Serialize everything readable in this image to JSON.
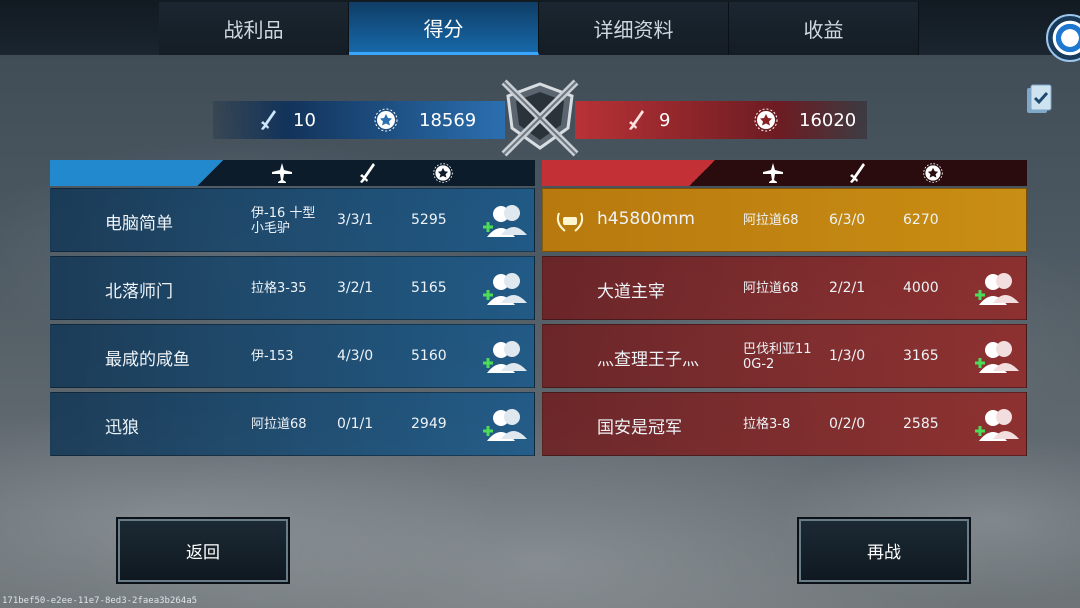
{
  "tabs": [
    {
      "label": "战利品"
    },
    {
      "label": "得分"
    },
    {
      "label": "详细资料"
    },
    {
      "label": "收益"
    }
  ],
  "active_tab": "得分",
  "blue_team": {
    "kills": "10",
    "score": "18569",
    "rows": [
      {
        "name": "电脑简单",
        "plane": "伊-16 十型\n小毛驴",
        "kda": "3/3/1",
        "score": "5295"
      },
      {
        "name": "北落师门",
        "plane": "拉格3-35",
        "kda": "3/2/1",
        "score": "5165"
      },
      {
        "name": "最咸的咸鱼",
        "plane": "伊-153",
        "kda": "4/3/0",
        "score": "5160"
      },
      {
        "name": "迅狼",
        "plane": "阿拉道68",
        "kda": "0/1/1",
        "score": "2949"
      }
    ]
  },
  "red_team": {
    "kills": "9",
    "score": "16020",
    "rows": [
      {
        "name": "h45800mm",
        "plane": "阿拉道68",
        "kda": "6/3/0",
        "score": "6270",
        "highlight": true
      },
      {
        "name": "大道主宰",
        "plane": "阿拉道68",
        "kda": "2/2/1",
        "score": "4000"
      },
      {
        "name": "灬查理王子灬",
        "plane": "巴伐利亚11\n0G-2",
        "kda": "1/3/0",
        "score": "3165"
      },
      {
        "name": "国安是冠军",
        "plane": "拉格3-8",
        "kda": "0/2/0",
        "score": "2585"
      }
    ]
  },
  "buttons": {
    "back": "返回",
    "rematch": "再战"
  },
  "footer_id": "171bef50-e2ee-11e7-8ed3-2faea3b264a5",
  "icons": {
    "plane": "plane-icon",
    "sword": "sword-icon",
    "star": "star-medal-icon",
    "add_friend": "add-friend-icon",
    "clipboard": "clipboard-check-icon"
  },
  "colors": {
    "blue": "#2389cf",
    "red": "#c33035",
    "gold": "#c98e14",
    "active_tab": "#1768a8"
  }
}
